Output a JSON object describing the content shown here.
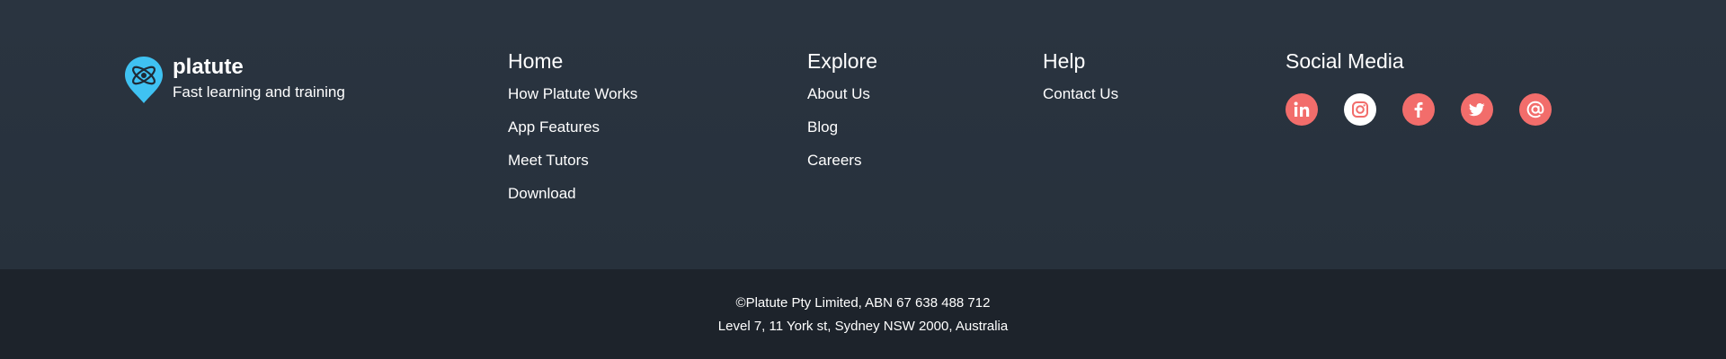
{
  "brand": {
    "name": "platute",
    "tagline": "Fast learning and training",
    "logo_color": "#3fc2f2",
    "logo_icon": "atom-pin-icon"
  },
  "columns": {
    "home": {
      "heading": "Home",
      "links": [
        "How Platute Works",
        "App Features",
        "Meet Tutors",
        "Download"
      ]
    },
    "explore": {
      "heading": "Explore",
      "links": [
        "About Us",
        "Blog",
        "Careers"
      ]
    },
    "help": {
      "heading": "Help",
      "links": [
        "Contact Us"
      ]
    },
    "social": {
      "heading": "Social Media",
      "icons": [
        "linkedin-icon",
        "instagram-icon",
        "facebook-icon",
        "twitter-icon",
        "email-icon"
      ],
      "accent_color": "#f26d6b"
    }
  },
  "bottom": {
    "line1": "©Platute Pty Limited, ABN 67 638 488 712",
    "line2": "Level 7, 11 York st, Sydney NSW 2000, Australia"
  }
}
